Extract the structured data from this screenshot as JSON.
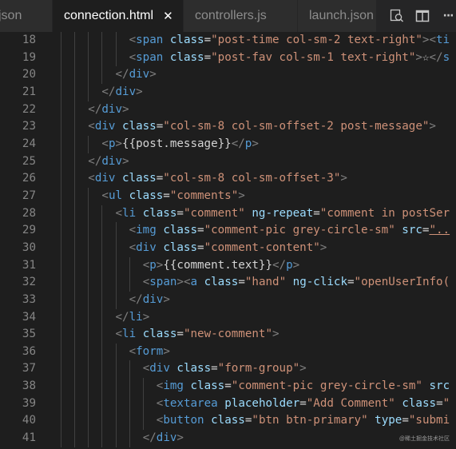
{
  "tabs": [
    {
      "label": "json",
      "active": false
    },
    {
      "label": "connection.html",
      "active": true,
      "close_glyph": "✕"
    },
    {
      "label": "controllers.js",
      "active": false
    },
    {
      "label": "launch.json",
      "active": false
    }
  ],
  "tab_actions": [
    {
      "icon": "open-preview-icon"
    },
    {
      "icon": "split-editor-icon"
    },
    {
      "icon": "more-actions-icon",
      "glyph": "···"
    }
  ],
  "colors": {
    "background": "#1e1e1e",
    "tag": "#569cd6",
    "attribute": "#9cdcfe",
    "string": "#ce9178",
    "text": "#d4d4d4",
    "line_number": "#858585"
  },
  "editor": {
    "lines": [
      {
        "n": "18",
        "indent": 6,
        "tokens": [
          [
            "p",
            "<"
          ],
          [
            "tag",
            "span"
          ],
          [
            "t",
            " "
          ],
          [
            "attr",
            "class"
          ],
          [
            "t",
            "="
          ],
          [
            "str",
            "\"post-time col-sm-2 text-right\""
          ],
          [
            "p",
            ">"
          ],
          [
            "p",
            "<"
          ],
          [
            "tag",
            "ti"
          ]
        ]
      },
      {
        "n": "19",
        "indent": 6,
        "tokens": [
          [
            "p",
            "<"
          ],
          [
            "tag",
            "span"
          ],
          [
            "t",
            " "
          ],
          [
            "attr",
            "class"
          ],
          [
            "t",
            "="
          ],
          [
            "str",
            "\"post-fav col-sm-1 text-right\""
          ],
          [
            "p",
            ">"
          ],
          [
            "t",
            "☆"
          ],
          [
            "p",
            "</"
          ],
          [
            "tag",
            "s"
          ]
        ]
      },
      {
        "n": "20",
        "indent": 5,
        "tokens": [
          [
            "p",
            "</"
          ],
          [
            "tag",
            "div"
          ],
          [
            "p",
            ">"
          ]
        ]
      },
      {
        "n": "21",
        "indent": 4,
        "tokens": [
          [
            "p",
            "</"
          ],
          [
            "tag",
            "div"
          ],
          [
            "p",
            ">"
          ]
        ]
      },
      {
        "n": "22",
        "indent": 3,
        "tokens": [
          [
            "p",
            "</"
          ],
          [
            "tag",
            "div"
          ],
          [
            "p",
            ">"
          ]
        ]
      },
      {
        "n": "23",
        "indent": 3,
        "tokens": [
          [
            "p",
            "<"
          ],
          [
            "tag",
            "div"
          ],
          [
            "t",
            " "
          ],
          [
            "attr",
            "class"
          ],
          [
            "t",
            "="
          ],
          [
            "str",
            "\"col-sm-8 col-sm-offset-2 post-message\""
          ],
          [
            "p",
            ">"
          ]
        ]
      },
      {
        "n": "24",
        "indent": 4,
        "tokens": [
          [
            "p",
            "<"
          ],
          [
            "tag",
            "p"
          ],
          [
            "p",
            ">"
          ],
          [
            "t",
            "{{post.message}}"
          ],
          [
            "p",
            "</"
          ],
          [
            "tag",
            "p"
          ],
          [
            "p",
            ">"
          ]
        ]
      },
      {
        "n": "25",
        "indent": 3,
        "tokens": [
          [
            "p",
            "</"
          ],
          [
            "tag",
            "div"
          ],
          [
            "p",
            ">"
          ]
        ]
      },
      {
        "n": "26",
        "indent": 3,
        "tokens": [
          [
            "p",
            "<"
          ],
          [
            "tag",
            "div"
          ],
          [
            "t",
            " "
          ],
          [
            "attr",
            "class"
          ],
          [
            "t",
            "="
          ],
          [
            "str",
            "\"col-sm-8 col-sm-offset-3\""
          ],
          [
            "p",
            ">"
          ]
        ]
      },
      {
        "n": "27",
        "indent": 4,
        "tokens": [
          [
            "p",
            "<"
          ],
          [
            "tag",
            "ul"
          ],
          [
            "t",
            " "
          ],
          [
            "attr",
            "class"
          ],
          [
            "t",
            "="
          ],
          [
            "str",
            "\"comments\""
          ],
          [
            "p",
            ">"
          ]
        ]
      },
      {
        "n": "28",
        "indent": 5,
        "tokens": [
          [
            "p",
            "<"
          ],
          [
            "tag",
            "li"
          ],
          [
            "t",
            " "
          ],
          [
            "attr",
            "class"
          ],
          [
            "t",
            "="
          ],
          [
            "str",
            "\"comment\""
          ],
          [
            "t",
            " "
          ],
          [
            "attr",
            "ng-repeat"
          ],
          [
            "t",
            "="
          ],
          [
            "str",
            "\"comment in postSer"
          ]
        ]
      },
      {
        "n": "29",
        "indent": 6,
        "tokens": [
          [
            "p",
            "<"
          ],
          [
            "tag",
            "img"
          ],
          [
            "t",
            " "
          ],
          [
            "attr",
            "class"
          ],
          [
            "t",
            "="
          ],
          [
            "str",
            "\"comment-pic grey-circle-sm\""
          ],
          [
            "t",
            " "
          ],
          [
            "attr",
            "src"
          ],
          [
            "t",
            "="
          ],
          [
            "link",
            "\".."
          ]
        ]
      },
      {
        "n": "30",
        "indent": 6,
        "tokens": [
          [
            "p",
            "<"
          ],
          [
            "tag",
            "div"
          ],
          [
            "t",
            " "
          ],
          [
            "attr",
            "class"
          ],
          [
            "t",
            "="
          ],
          [
            "str",
            "\"comment-content\""
          ],
          [
            "p",
            ">"
          ]
        ]
      },
      {
        "n": "31",
        "indent": 7,
        "tokens": [
          [
            "p",
            "<"
          ],
          [
            "tag",
            "p"
          ],
          [
            "p",
            ">"
          ],
          [
            "t",
            "{{comment.text}}"
          ],
          [
            "p",
            "</"
          ],
          [
            "tag",
            "p"
          ],
          [
            "p",
            ">"
          ]
        ]
      },
      {
        "n": "32",
        "indent": 7,
        "tokens": [
          [
            "p",
            "<"
          ],
          [
            "tag",
            "span"
          ],
          [
            "p",
            ">"
          ],
          [
            "p",
            "<"
          ],
          [
            "tag",
            "a"
          ],
          [
            "t",
            " "
          ],
          [
            "attr",
            "class"
          ],
          [
            "t",
            "="
          ],
          [
            "str",
            "\"hand\""
          ],
          [
            "t",
            " "
          ],
          [
            "attr",
            "ng-click"
          ],
          [
            "t",
            "="
          ],
          [
            "str",
            "\"openUserInfo("
          ]
        ]
      },
      {
        "n": "33",
        "indent": 6,
        "tokens": [
          [
            "p",
            "</"
          ],
          [
            "tag",
            "div"
          ],
          [
            "p",
            ">"
          ]
        ]
      },
      {
        "n": "34",
        "indent": 5,
        "tokens": [
          [
            "p",
            "</"
          ],
          [
            "tag",
            "li"
          ],
          [
            "p",
            ">"
          ]
        ]
      },
      {
        "n": "35",
        "indent": 5,
        "tokens": [
          [
            "p",
            "<"
          ],
          [
            "tag",
            "li"
          ],
          [
            "t",
            " "
          ],
          [
            "attr",
            "class"
          ],
          [
            "t",
            "="
          ],
          [
            "str",
            "\"new-comment\""
          ],
          [
            "p",
            ">"
          ]
        ]
      },
      {
        "n": "36",
        "indent": 6,
        "tokens": [
          [
            "p",
            "<"
          ],
          [
            "tag",
            "form"
          ],
          [
            "p",
            ">"
          ]
        ]
      },
      {
        "n": "37",
        "indent": 7,
        "tokens": [
          [
            "p",
            "<"
          ],
          [
            "tag",
            "div"
          ],
          [
            "t",
            " "
          ],
          [
            "attr",
            "class"
          ],
          [
            "t",
            "="
          ],
          [
            "str",
            "\"form-group\""
          ],
          [
            "p",
            ">"
          ]
        ]
      },
      {
        "n": "38",
        "indent": 8,
        "tokens": [
          [
            "p",
            "<"
          ],
          [
            "tag",
            "img"
          ],
          [
            "t",
            " "
          ],
          [
            "attr",
            "class"
          ],
          [
            "t",
            "="
          ],
          [
            "str",
            "\"comment-pic grey-circle-sm\""
          ],
          [
            "t",
            " "
          ],
          [
            "attr",
            "src"
          ]
        ]
      },
      {
        "n": "39",
        "indent": 8,
        "tokens": [
          [
            "p",
            "<"
          ],
          [
            "tag",
            "textarea"
          ],
          [
            "t",
            " "
          ],
          [
            "attr",
            "placeholder"
          ],
          [
            "t",
            "="
          ],
          [
            "str",
            "\"Add Comment\""
          ],
          [
            "t",
            " "
          ],
          [
            "attr",
            "class"
          ],
          [
            "t",
            "="
          ],
          [
            "str",
            "\""
          ]
        ]
      },
      {
        "n": "40",
        "indent": 8,
        "tokens": [
          [
            "p",
            "<"
          ],
          [
            "tag",
            "button"
          ],
          [
            "t",
            " "
          ],
          [
            "attr",
            "class"
          ],
          [
            "t",
            "="
          ],
          [
            "str",
            "\"btn btn-primary\""
          ],
          [
            "t",
            " "
          ],
          [
            "attr",
            "type"
          ],
          [
            "t",
            "="
          ],
          [
            "str",
            "\"submi"
          ]
        ]
      },
      {
        "n": "41",
        "indent": 7,
        "tokens": [
          [
            "p",
            "</"
          ],
          [
            "tag",
            "div"
          ],
          [
            "p",
            ">"
          ]
        ]
      }
    ]
  },
  "watermark": "@稀土掘金技术社区"
}
